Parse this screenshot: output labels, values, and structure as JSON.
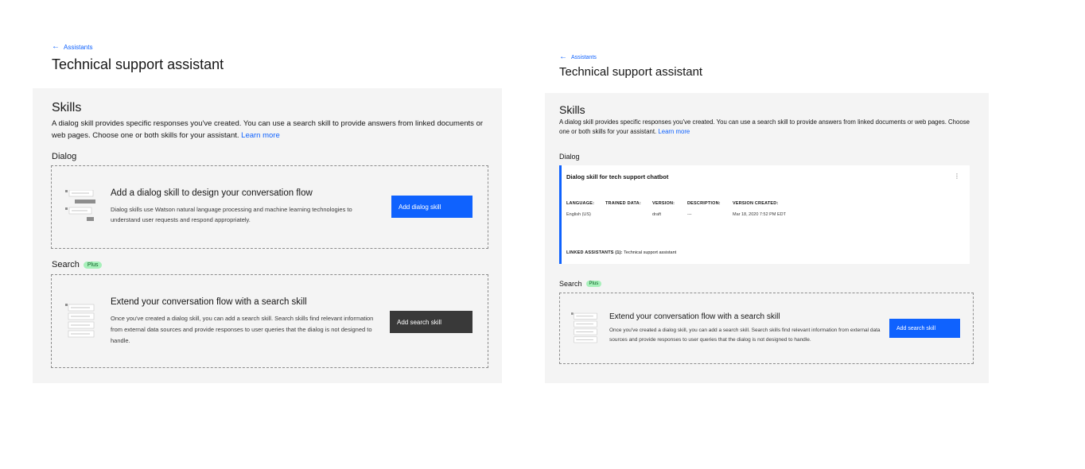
{
  "left": {
    "back_link": "Assistants",
    "title": "Technical support assistant",
    "skills": {
      "heading": "Skills",
      "description": "A dialog skill provides specific responses you've created. You can use a search skill to provide answers from linked documents or web pages. Choose one or both skills for your assistant.",
      "learn_more": "Learn more"
    },
    "dialog": {
      "label": "Dialog",
      "tile_heading": "Add a dialog skill to design your conversation flow",
      "tile_text": "Dialog skills use Watson natural language processing and machine learning technologies to understand user requests and respond appropriately.",
      "button": "Add dialog skill"
    },
    "search": {
      "label": "Search",
      "tag": "Plus",
      "tile_heading": "Extend your conversation flow with a search skill",
      "tile_text": "Once you've created a dialog skill, you can add a search skill. Search skills find relevant information from external data sources and provide responses to user queries that the dialog is not designed to handle.",
      "button": "Add search skill"
    }
  },
  "right": {
    "back_link": "Assistants",
    "title": "Technical support assistant",
    "skills": {
      "heading": "Skills",
      "description": "A dialog skill provides specific responses you've created. You can use a search skill to provide answers from linked documents or web pages. Choose one or both skills for your assistant.",
      "learn_more": "Learn more"
    },
    "dialog": {
      "label": "Dialog",
      "card": {
        "title": "Dialog skill for tech support chatbot",
        "menu": "⋮",
        "meta": [
          {
            "label": "LANGUAGE:",
            "value": "English (US)"
          },
          {
            "label": "TRAINED DATA:",
            "value": ""
          },
          {
            "label": "VERSION:",
            "value": "draft"
          },
          {
            "label": "DESCRIPTION:",
            "value": "---"
          },
          {
            "label": "VERSION CREATED:",
            "value": "Mar 18, 2020 7:52 PM EDT"
          }
        ],
        "linked_label": "LINKED ASSISTANTS (1):",
        "linked_value": "Technical support assistant"
      }
    },
    "search": {
      "label": "Search",
      "tag": "Plus",
      "tile_heading": "Extend your conversation flow with a search skill",
      "tile_text": "Once you've created a dialog skill, you can add a search skill. Search skills find relevant information from external data sources and provide responses to user queries that the dialog is not designed to handle.",
      "button": "Add search skill"
    }
  },
  "colors": {
    "primary": "#0f62fe",
    "dark_button": "#393939",
    "panel_bg": "#f4f4f4",
    "tag_bg": "#a7f0ba",
    "tag_text": "#0e6027"
  }
}
